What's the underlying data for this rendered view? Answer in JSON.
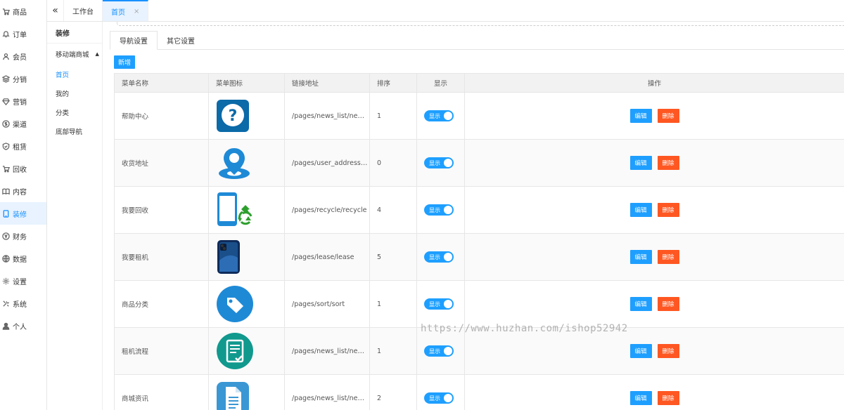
{
  "sidebar": {
    "items": [
      {
        "label": "商品",
        "icon": "cart-icon"
      },
      {
        "label": "订单",
        "icon": "bell-icon"
      },
      {
        "label": "会员",
        "icon": "user-icon"
      },
      {
        "label": "分销",
        "icon": "layers-icon"
      },
      {
        "label": "营销",
        "icon": "diamond-icon"
      },
      {
        "label": "渠道",
        "icon": "dollar-circle-icon"
      },
      {
        "label": "租赁",
        "icon": "shield-icon"
      },
      {
        "label": "回收",
        "icon": "cart-icon"
      },
      {
        "label": "内容",
        "icon": "book-icon"
      },
      {
        "label": "装修",
        "icon": "tablet-icon"
      },
      {
        "label": "财务",
        "icon": "yen-circle-icon"
      },
      {
        "label": "数据",
        "icon": "globe-icon"
      },
      {
        "label": "设置",
        "icon": "gear-icon"
      },
      {
        "label": "系统",
        "icon": "tools-icon"
      },
      {
        "label": "个人",
        "icon": "person-icon"
      }
    ],
    "active_index": 9
  },
  "topbar": {
    "tabs": [
      {
        "label": "工作台"
      },
      {
        "label": "首页",
        "close": "×"
      }
    ]
  },
  "subnav": {
    "title": "装修",
    "group": "移动端商城",
    "links": [
      "首页",
      "我的",
      "分类",
      "底部导航"
    ]
  },
  "content": {
    "tabs": [
      "导航设置",
      "其它设置"
    ],
    "add_button": "新增",
    "columns": [
      "菜单名称",
      "菜单图标",
      "链接地址",
      "排序",
      "显示",
      "操作"
    ],
    "rows": [
      {
        "name": "帮助中心",
        "icon": "help-question-icon",
        "link": "/pages/news_list/news_list",
        "sort": "1",
        "show": "显示"
      },
      {
        "name": "收货地址",
        "icon": "location-pin-icon",
        "link": "/pages/user_address/user_address",
        "sort": "0",
        "show": "显示"
      },
      {
        "name": "我要回收",
        "icon": "phone-recycle-icon",
        "link": "/pages/recycle/recycle",
        "sort": "4",
        "show": "显示"
      },
      {
        "name": "我要租机",
        "icon": "smartphone-icon",
        "link": "/pages/lease/lease",
        "sort": "5",
        "show": "显示"
      },
      {
        "name": "商品分类",
        "icon": "price-tag-icon",
        "link": "/pages/sort/sort",
        "sort": "1",
        "show": "显示"
      },
      {
        "name": "租机流程",
        "icon": "document-check-icon",
        "link": "/pages/news_list/news_list",
        "sort": "1",
        "show": "显示"
      },
      {
        "name": "商城资讯",
        "icon": "document-icon",
        "link": "/pages/news_list/news_list",
        "sort": "2",
        "show": "显示"
      }
    ],
    "edit_label": "编辑",
    "delete_label": "删除"
  },
  "watermark": "https://www.huzhan.com/ishop52942",
  "colors": {
    "primary": "#1e9fff",
    "danger": "#ff5722",
    "active_bg": "#e8f3ff"
  }
}
